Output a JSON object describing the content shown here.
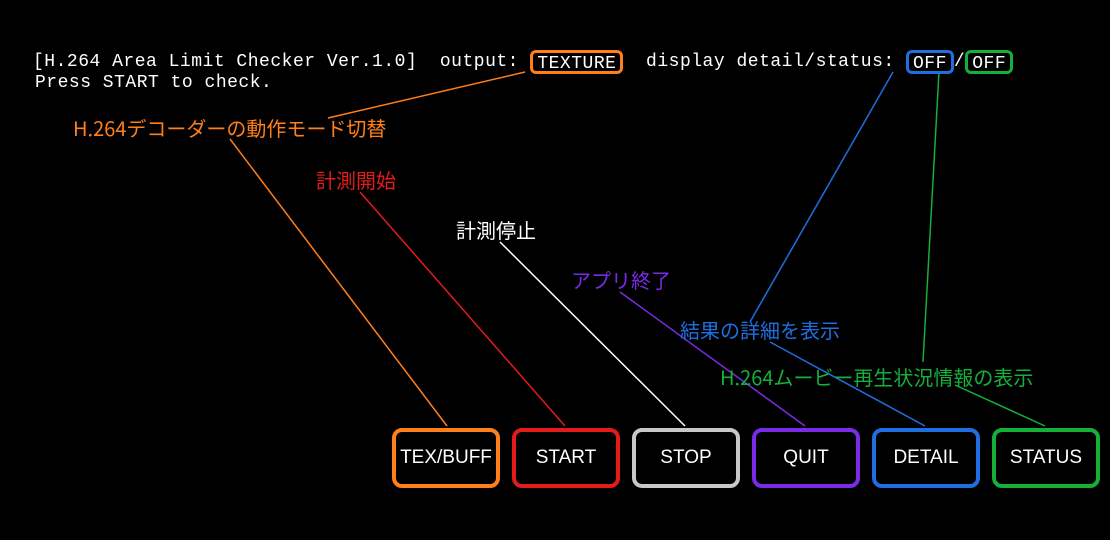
{
  "header": {
    "title": "[H.264 Area Limit Checker Ver.1.0]",
    "output_label": "output:",
    "output_value": "TEXTURE",
    "detail_status_label": "display detail/status:",
    "detail_value": "OFF",
    "status_value": "OFF",
    "subline": "Press START to check."
  },
  "annotations": {
    "mode_switch": "H.264デコーダーの動作モード切替",
    "start": "計測開始",
    "stop": "計測停止",
    "quit": "アプリ終了",
    "detail": "結果の詳細を表示",
    "status": "H.264ムービー再生状況情報の表示"
  },
  "buttons": {
    "texbuff": "TEX/BUFF",
    "start": "START",
    "stop": "STOP",
    "quit": "QUIT",
    "detail": "DETAIL",
    "status": "STATUS"
  },
  "colors": {
    "orange": "#ff7f1a",
    "red": "#e31b1b",
    "white": "#ffffff",
    "gray": "#c8c8c8",
    "purple": "#7a2be6",
    "blue": "#1e6fe0",
    "green": "#14b03a"
  }
}
